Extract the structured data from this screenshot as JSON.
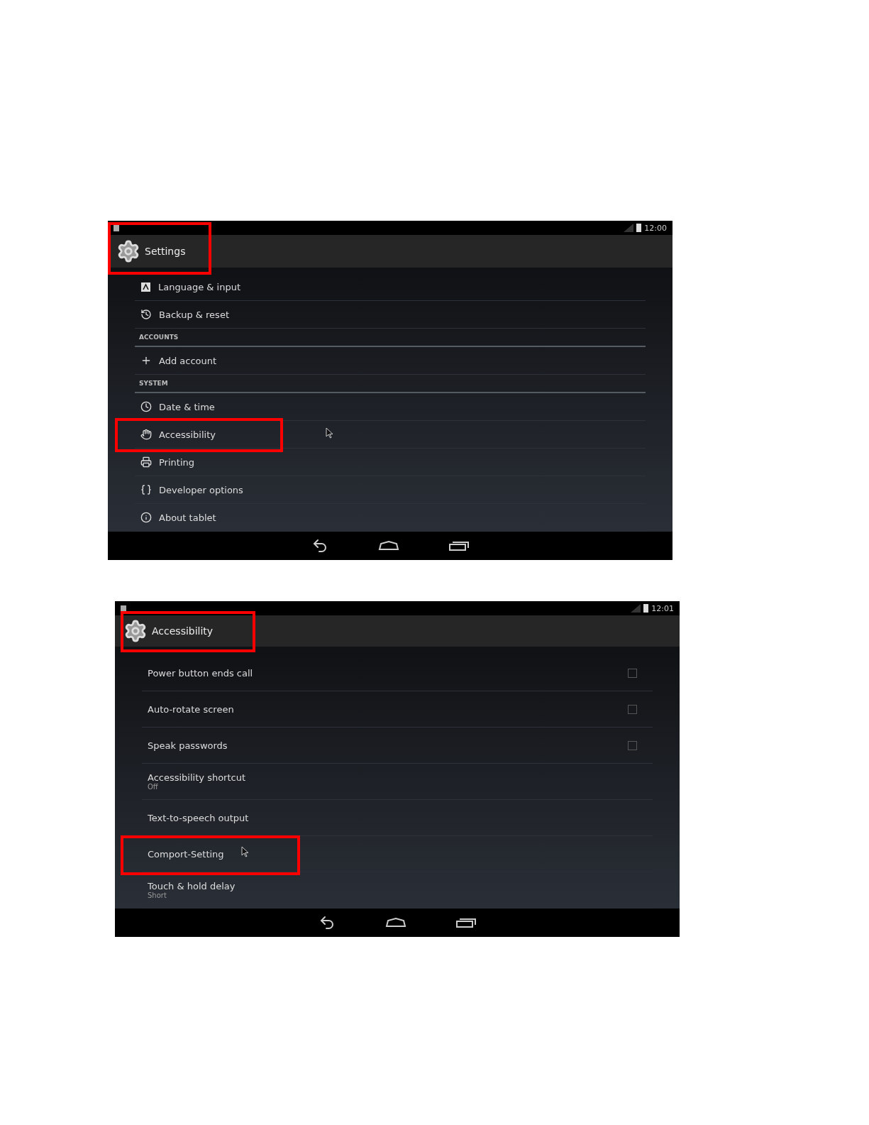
{
  "screens": [
    {
      "status_time": "12:00",
      "title": "Settings",
      "title_highlighted": true,
      "kind": "settings",
      "items": [
        {
          "kind": "item",
          "label": "Language & input",
          "highlighted": false
        },
        {
          "kind": "item",
          "label": "Backup & reset",
          "highlighted": false
        },
        {
          "kind": "header",
          "label": "ACCOUNTS"
        },
        {
          "kind": "item",
          "label": "Add account",
          "highlighted": false
        },
        {
          "kind": "header",
          "label": "SYSTEM"
        },
        {
          "kind": "item",
          "label": "Date & time",
          "highlighted": false
        },
        {
          "kind": "item",
          "label": "Accessibility",
          "highlighted": true
        },
        {
          "kind": "item",
          "label": "Printing",
          "highlighted": false
        },
        {
          "kind": "item",
          "label": "Developer options",
          "highlighted": false
        },
        {
          "kind": "item",
          "label": "About tablet",
          "highlighted": false
        }
      ]
    },
    {
      "status_time": "12:01",
      "title": "Accessibility",
      "title_highlighted": true,
      "kind": "accessibility",
      "items": [
        {
          "kind": "check",
          "label": "Power button ends call",
          "checked": false,
          "highlighted": false
        },
        {
          "kind": "check",
          "label": "Auto-rotate screen",
          "checked": false,
          "highlighted": false
        },
        {
          "kind": "check",
          "label": "Speak passwords",
          "checked": false,
          "highlighted": false
        },
        {
          "kind": "text",
          "label": "Accessibility shortcut",
          "sub": "Off",
          "highlighted": false
        },
        {
          "kind": "text",
          "label": "Text-to-speech output",
          "highlighted": false
        },
        {
          "kind": "text",
          "label": "Comport-Setting",
          "highlighted": true
        },
        {
          "kind": "text",
          "label": "Touch & hold delay",
          "sub": "Short",
          "highlighted": false
        }
      ]
    }
  ]
}
